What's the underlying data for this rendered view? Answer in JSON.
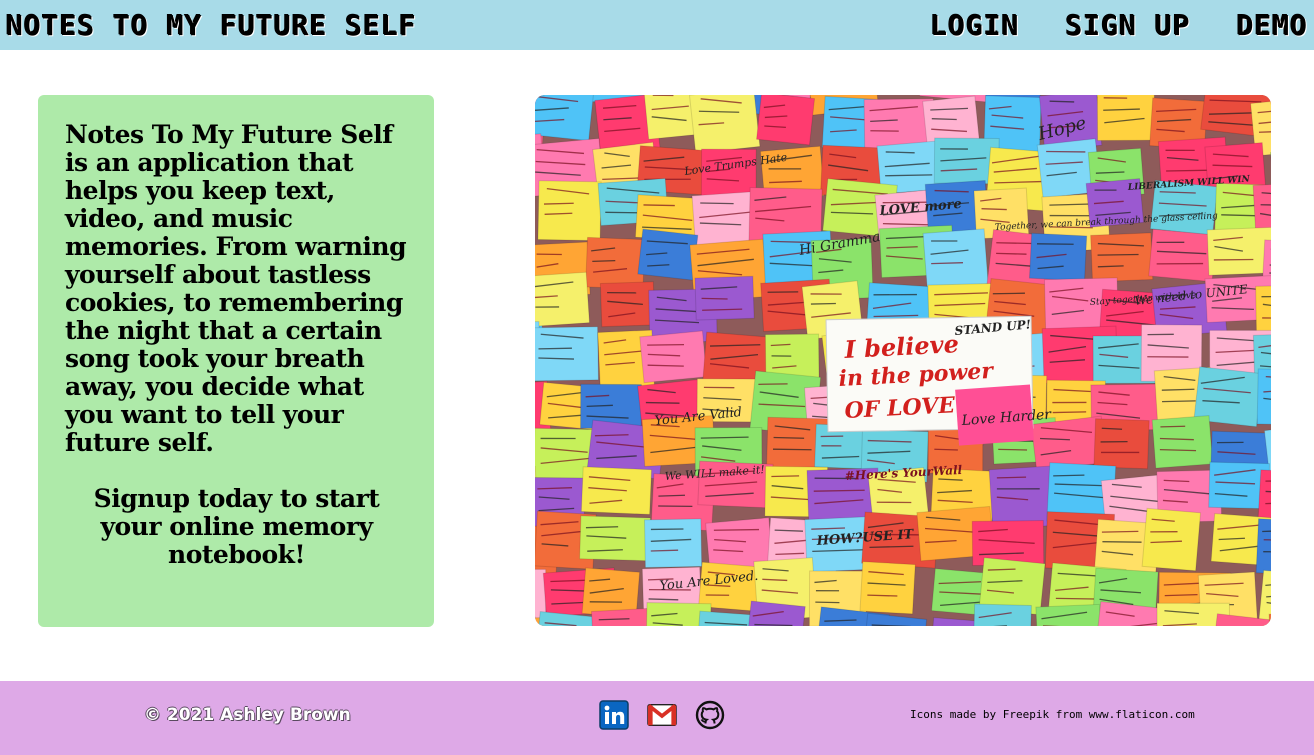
{
  "header": {
    "brand": "Notes To My Future Self",
    "nav": [
      {
        "label": "Login"
      },
      {
        "label": "Sign Up"
      },
      {
        "label": "Demo"
      }
    ]
  },
  "intro": {
    "paragraph": "Notes To My Future Self is an application that helps you keep text, video, and music memories. From warning yourself about tastless cookies, to remembering the night that a certain song took your breath away, you decide what you want to tell your future self.",
    "cta": "Signup today to start your online memory notebook!"
  },
  "hero": {
    "image_alt": "wall of colorful sticky notes",
    "notes": [
      {
        "text": "I believe"
      },
      {
        "text": "in the power"
      },
      {
        "text": "OF LOVE"
      },
      {
        "text": "Love Harder"
      },
      {
        "text": "Hope"
      },
      {
        "text": "Hi Gramma"
      },
      {
        "text": "Love Trumps Hate"
      },
      {
        "text": "LOVE more"
      },
      {
        "text": "Together, we can break through the glass ceiling"
      },
      {
        "text": "STAND UP!"
      },
      {
        "text": "You Are Valid"
      },
      {
        "text": "We WILL make it!"
      },
      {
        "text": "#Here's YourWall"
      },
      {
        "text": "HOW?USE IT"
      },
      {
        "text": "You Are Loved."
      },
      {
        "text": "We need to UNITE"
      },
      {
        "text": "Stay together with love"
      },
      {
        "text": "LIBERALISM WILL WIN"
      }
    ]
  },
  "footer": {
    "copyright": "© 2021 Ashley Brown",
    "icons": [
      {
        "name": "linkedin-icon",
        "color": "#0a66c2"
      },
      {
        "name": "gmail-icon",
        "color": "#d93025"
      },
      {
        "name": "github-icon",
        "color": "#111111"
      }
    ],
    "credit": "Icons made by Freepik from www.flaticon.com"
  },
  "colors": {
    "header_bg": "#a8dbe8",
    "card_bg": "#aeeaa9",
    "footer_bg": "#dea9e7"
  }
}
